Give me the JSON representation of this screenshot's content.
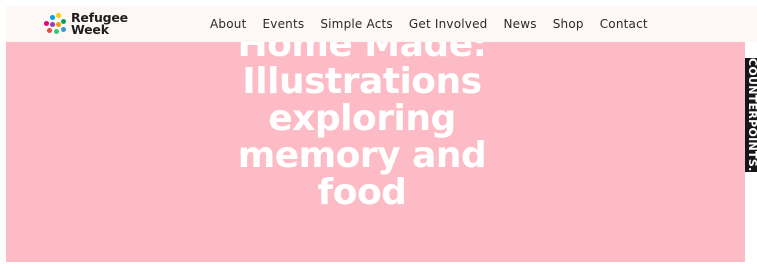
{
  "header": {
    "logo": {
      "line1": "Refugee",
      "line2": "Week",
      "dot_colors": [
        "#e6007e",
        "#00a0e3",
        "#ffcc00",
        "#00a651",
        "#8e44ad",
        "#f39c12",
        "#e74c3c",
        "#2ecc71",
        "#3498db"
      ]
    },
    "nav": [
      {
        "label": "About"
      },
      {
        "label": "Events"
      },
      {
        "label": "Simple Acts"
      },
      {
        "label": "Get Involved"
      },
      {
        "label": "News"
      },
      {
        "label": "Shop"
      },
      {
        "label": "Contact"
      }
    ]
  },
  "hero": {
    "title": "Home Made: Illustrations exploring memory and food",
    "background_color": "#fdbcc5",
    "text_color": "#ffffff"
  },
  "side_tab": {
    "label": "COUNTERPOINTS.",
    "background_color": "#161616"
  }
}
